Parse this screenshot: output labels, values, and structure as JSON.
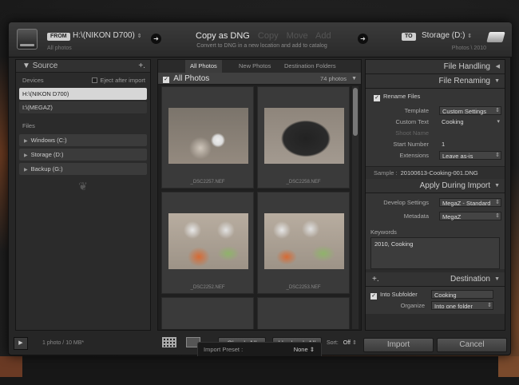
{
  "header": {
    "from_tag": "FROM",
    "source_name": "H:\\(NIKON D700)",
    "source_sub": "All photos",
    "modes": [
      "Copy as DNG",
      "Copy",
      "Move",
      "Add"
    ],
    "mode_description": "Convert to DNG in a new location and add to catalog",
    "to_tag": "TO",
    "dest_name": "Storage (D:)",
    "dest_sub": "Photos \\ 2010"
  },
  "source_panel": {
    "title": "Source",
    "plus": "+.",
    "devices_label": "Devices",
    "eject_label": "Eject after import",
    "devices": [
      "H:\\(NIKON D700)",
      "I:\\(MEGAZ)"
    ],
    "files_label": "Files",
    "files": [
      "Windows (C:)",
      "Storage (D:)",
      "Backup (G:)"
    ]
  },
  "center": {
    "tabs": [
      "All Photos",
      "New Photos",
      "Destination Folders"
    ],
    "bar_title": "All Photos",
    "bar_count": "74 photos",
    "thumbnails": [
      {
        "name": "_DSC2257.NEF"
      },
      {
        "name": "_DSC2258.NEF"
      },
      {
        "name": "_DSC2252.NEF"
      },
      {
        "name": "_DSC2253.NEF"
      }
    ],
    "check_all": "Check All",
    "uncheck_all": "Uncheck All",
    "sort_label": "Sort:",
    "sort_value": "Off"
  },
  "right_panel": {
    "file_handling": "File Handling",
    "file_renaming": "File Renaming",
    "rename_files": "Rename Files",
    "template_label": "Template",
    "template_value": "Custom Settings",
    "custom_text_label": "Custom Text",
    "custom_text_value": "Cooking",
    "shoot_name_label": "Shoot Name",
    "start_number_label": "Start Number",
    "start_number_value": "1",
    "extensions_label": "Extensions",
    "extensions_value": "Leave as-is",
    "sample_label": "Sample :",
    "sample_value": "20100613-Cooking-001.DNG",
    "apply_during_import": "Apply During Import",
    "develop_label": "Develop Settings",
    "develop_value": "MegaZ - Standard",
    "metadata_label": "Metadata",
    "metadata_value": "MegaZ",
    "keywords_label": "Keywords",
    "keywords_value": "2010, Cooking",
    "destination": "Destination",
    "dest_plus": "+.",
    "into_subfolder": "Into Subfolder",
    "subfolder_value": "Cooking",
    "organize_label": "Organize",
    "organize_value": "Into one folder"
  },
  "footer": {
    "info": "1 photo / 10 MB*",
    "preset_label": "Import Preset :",
    "preset_value": "None ⇕",
    "import": "Import",
    "cancel": "Cancel"
  }
}
